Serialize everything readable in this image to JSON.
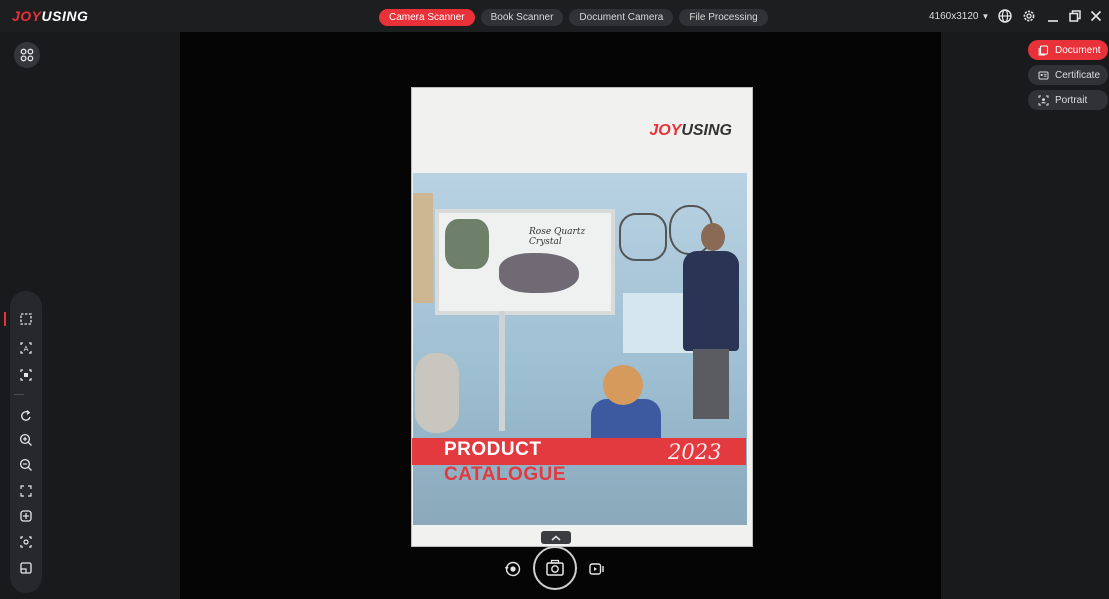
{
  "brand": {
    "j": "JOY",
    "u": "USING"
  },
  "top_tabs": [
    {
      "label": "Camera Scanner",
      "active": true
    },
    {
      "label": "Book Scanner",
      "active": false
    },
    {
      "label": "Document Camera",
      "active": false
    },
    {
      "label": "File Processing",
      "active": false
    }
  ],
  "resolution": {
    "value": "4160x3120",
    "caret": "▼"
  },
  "window_controls": {
    "language_icon": "globe-icon",
    "settings_icon": "gear-icon",
    "minimize_icon": "minimize-icon",
    "restore_icon": "restore-icon",
    "close_icon": "close-icon"
  },
  "scan_modes": [
    {
      "label": "Document",
      "icon": "document-icon",
      "active": true
    },
    {
      "label": "Certificate",
      "icon": "id-card-icon",
      "active": false
    },
    {
      "label": "Portrait",
      "icon": "portrait-icon",
      "active": false
    }
  ],
  "document_preview": {
    "logo_j": "JOY",
    "logo_u": "USING",
    "line1": "PRODUCT",
    "line2": "CATALOGUE",
    "year": "2023",
    "board_text": "Rose Quartz Crystal"
  },
  "colors": {
    "accent": "#e9313a",
    "panel": "#191a1c",
    "topbar": "#1d1e20"
  }
}
